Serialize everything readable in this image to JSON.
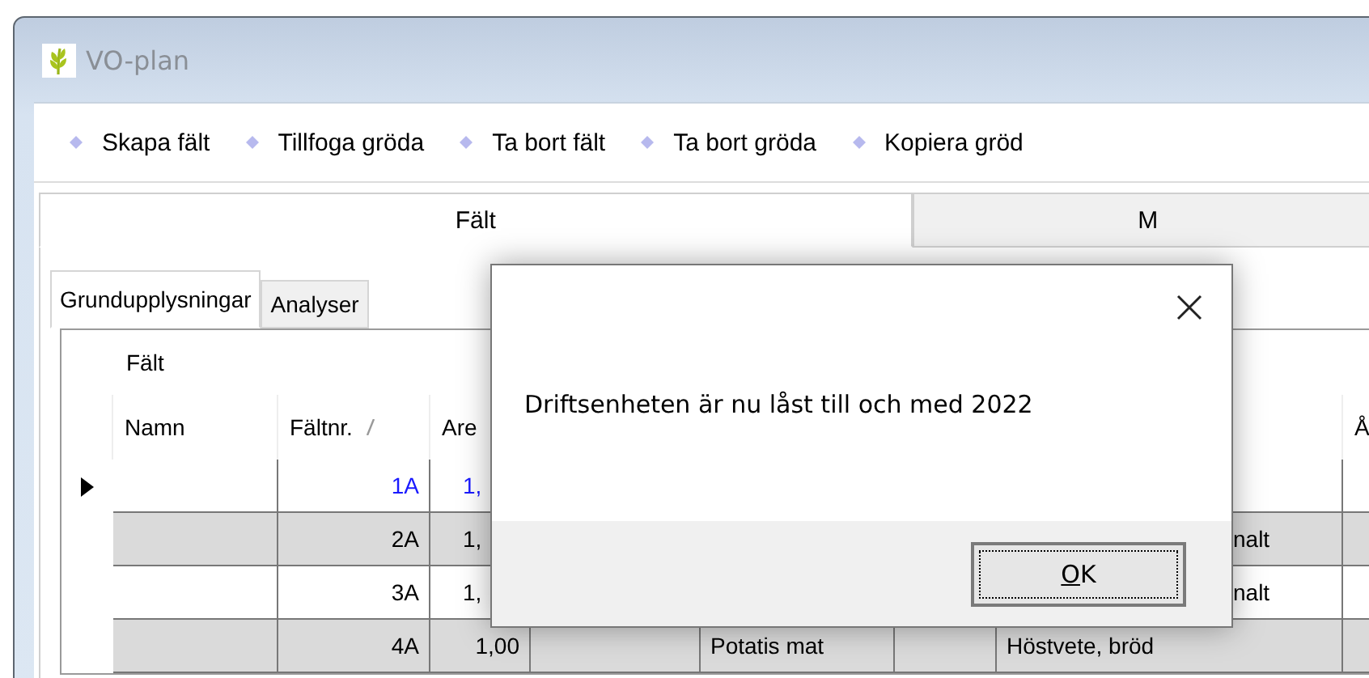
{
  "window": {
    "title": "VO-plan"
  },
  "toolbar": [
    {
      "label": "Skapa fält"
    },
    {
      "label": "Tillfoga gröda"
    },
    {
      "label": "Ta bort fält"
    },
    {
      "label": "Ta bort gröda"
    },
    {
      "label": "Kopiera gröd"
    }
  ],
  "tabs": [
    {
      "label": "Fält",
      "selected": true
    },
    {
      "label": "M",
      "selected": false
    }
  ],
  "subtabs": [
    {
      "label": "Grundupplysningar",
      "selected": true
    },
    {
      "label": "Analyser",
      "selected": false
    }
  ],
  "table": {
    "group_header": "Fält",
    "columns": [
      {
        "label": "Namn"
      },
      {
        "label": "Fältnr.",
        "sorted": true
      },
      {
        "label": "Are"
      },
      {},
      {},
      {},
      {},
      {
        "label": "Å"
      }
    ],
    "rows": [
      {
        "selected": true,
        "cells": [
          "",
          "1A",
          "1,",
          "",
          "",
          "",
          "",
          ""
        ]
      },
      {
        "selected": false,
        "cells": [
          "",
          "2A",
          "1,",
          "",
          "",
          "",
          "nalt",
          ""
        ]
      },
      {
        "selected": false,
        "cells": [
          "",
          "3A",
          "1,",
          "",
          "",
          "",
          "nalt",
          ""
        ]
      },
      {
        "selected": false,
        "cells": [
          "",
          "4A",
          "1,00",
          "",
          "Potatis mat",
          "",
          "Höstvete, bröd",
          ""
        ]
      }
    ]
  },
  "dialog": {
    "message": "Driftsenheten är nu låst till och med 2022",
    "button": "OK"
  }
}
